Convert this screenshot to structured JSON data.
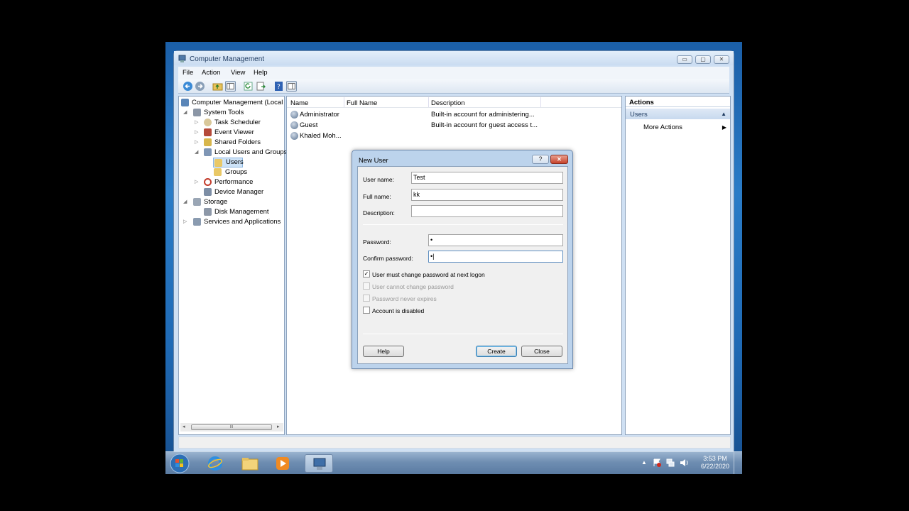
{
  "window": {
    "title": "Computer Management",
    "controls": {
      "minimize": "▭",
      "maximize": "▢",
      "close": "✕"
    }
  },
  "menu": [
    "File",
    "Action",
    "View",
    "Help"
  ],
  "tree": {
    "root": "Computer Management (Local",
    "system_tools": "System Tools",
    "task_scheduler": "Task Scheduler",
    "event_viewer": "Event Viewer",
    "shared_folders": "Shared Folders",
    "local_users_groups": "Local Users and Groups",
    "users": "Users",
    "groups": "Groups",
    "performance": "Performance",
    "device_manager": "Device Manager",
    "storage": "Storage",
    "disk_management": "Disk Management",
    "services_apps": "Services and Applications",
    "scroll_mark": "III"
  },
  "list": {
    "columns": [
      "Name",
      "Full Name",
      "Description"
    ],
    "rows": [
      {
        "name": "Administrator",
        "full_name": "",
        "description": "Built-in account for administering..."
      },
      {
        "name": "Guest",
        "full_name": "",
        "description": "Built-in account for guest access t..."
      },
      {
        "name": "Khaled Moh...",
        "full_name": "",
        "description": ""
      }
    ]
  },
  "dialog": {
    "title": "New User",
    "help_glyph": "?",
    "close_glyph": "✕",
    "username_label": "User name:",
    "username_value": "Test",
    "fullname_label": "Full name:",
    "fullname_value": "kk",
    "description_label": "Description:",
    "description_value": "",
    "password_label": "Password:",
    "password_value": "•",
    "confirm_label": "Confirm password:",
    "confirm_value": "•|",
    "checkboxes": [
      {
        "label": "User must change password at next logon",
        "checked": true,
        "enabled": true
      },
      {
        "label": "User cannot change password",
        "checked": false,
        "enabled": false
      },
      {
        "label": "Password never expires",
        "checked": false,
        "enabled": false
      },
      {
        "label": "Account is disabled",
        "checked": false,
        "enabled": true
      }
    ],
    "buttons": {
      "help": "Help",
      "create": "Create",
      "close": "Close"
    }
  },
  "actions": {
    "header": "Actions",
    "section": "Users",
    "more": "More Actions"
  },
  "taskbar": {
    "time": "3:53 PM",
    "date": "6/22/2020"
  }
}
